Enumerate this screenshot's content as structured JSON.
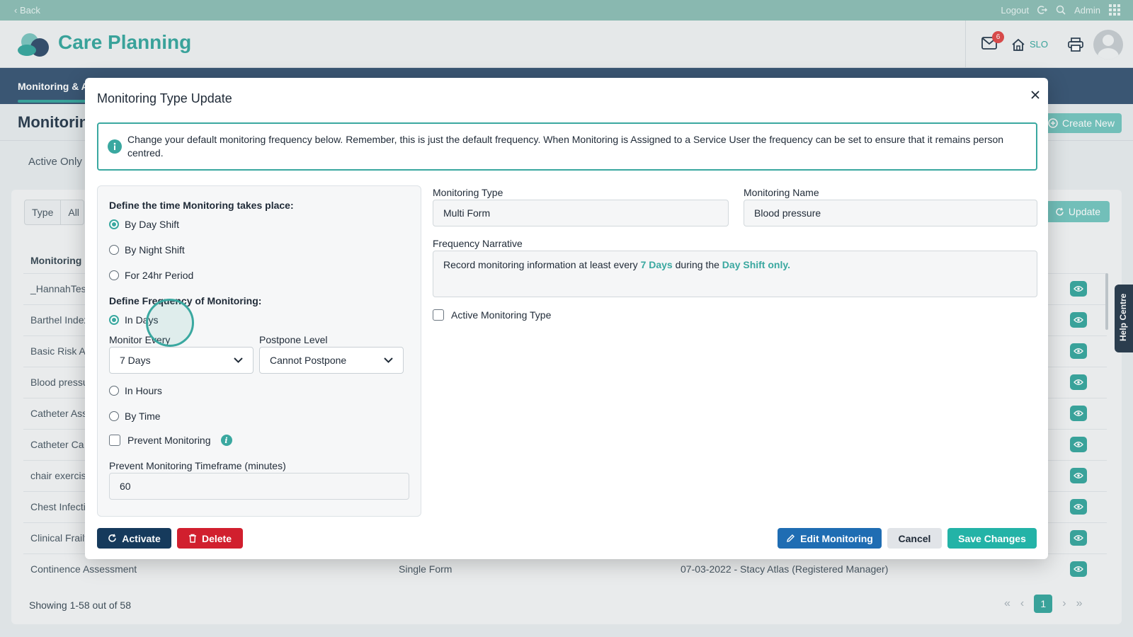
{
  "topbar": {
    "back_label": "‹ Back",
    "logout_label": "Logout",
    "admin_label": "Admin"
  },
  "header": {
    "app_title": "Care Planning",
    "mail_badge": "6",
    "home_label": "SLO"
  },
  "nav": {
    "active_tab": "Monitoring & A"
  },
  "background": {
    "page_title": "Monitorin",
    "create_new_label": "Create New",
    "active_only_label": "Active Only",
    "filter_type_label": "Type",
    "filter_value": "All",
    "update_label": "Update",
    "column_header": "Monitoring N",
    "rows": [
      {
        "name": "_HannahTes",
        "type": "",
        "created": ""
      },
      {
        "name": "Barthel Index",
        "type": "",
        "created": ""
      },
      {
        "name": "Basic Risk As",
        "type": "",
        "created": ""
      },
      {
        "name": "Blood pressu",
        "type": "",
        "created": ""
      },
      {
        "name": "Catheter Ass",
        "type": "",
        "created": ""
      },
      {
        "name": "Catheter Ca",
        "type": "",
        "created": ""
      },
      {
        "name": "chair exercis",
        "type": "",
        "created": ""
      },
      {
        "name": "Chest Infecti",
        "type": "",
        "created": ""
      },
      {
        "name": "Clinical Frailt",
        "type": "",
        "created": ""
      },
      {
        "name": "Continence Assessment",
        "type": "Single Form",
        "created": "07-03-2022 - Stacy Atlas (Registered Manager)"
      }
    ],
    "showing_text": "Showing 1-58 out of 58",
    "current_page": "1",
    "help_centre_label": "Help Centre"
  },
  "modal": {
    "title": "Monitoring Type Update",
    "alert_text": "Change your default monitoring frequency below. Remember, this is just the default frequency. When Monitoring is Assigned to a Service User the frequency can be set to ensure that it remains person centred.",
    "define_time_label": "Define the time Monitoring takes place:",
    "time_options": [
      {
        "label": "By Day Shift",
        "selected": true
      },
      {
        "label": "By Night Shift",
        "selected": false
      },
      {
        "label": "For 24hr Period",
        "selected": false
      }
    ],
    "define_frequency_label": "Define Frequency of Monitoring:",
    "in_days_label": "In Days",
    "monitor_every_label": "Monitor Every",
    "monitor_every_value": "7 Days",
    "postpone_level_label": "Postpone Level",
    "postpone_level_value": "Cannot Postpone",
    "in_hours_label": "In Hours",
    "by_time_label": "By Time",
    "prevent_monitoring_label": "Prevent Monitoring",
    "prevent_timeframe_label": "Prevent Monitoring Timeframe (minutes)",
    "prevent_timeframe_value": "60",
    "monitoring_type_label": "Monitoring Type",
    "monitoring_type_value": "Multi Form",
    "monitoring_name_label": "Monitoring Name",
    "monitoring_name_value": "Blood pressure",
    "frequency_narrative_label": "Frequency Narrative",
    "narrative_prefix": "Record monitoring information at least every",
    "narrative_freq": "7 Days",
    "narrative_mid": "during the",
    "narrative_shift": "Day Shift only.",
    "active_monitoring_label": "Active Monitoring Type",
    "activate_label": "Activate",
    "delete_label": "Delete",
    "edit_label": "Edit Monitoring",
    "cancel_label": "Cancel",
    "save_label": "Save Changes"
  },
  "colors": {
    "accent": "#3aa8a0",
    "nav": "#3b5877",
    "danger": "#d11f2e",
    "primary": "#1f6db3",
    "dark": "#163a5c"
  }
}
